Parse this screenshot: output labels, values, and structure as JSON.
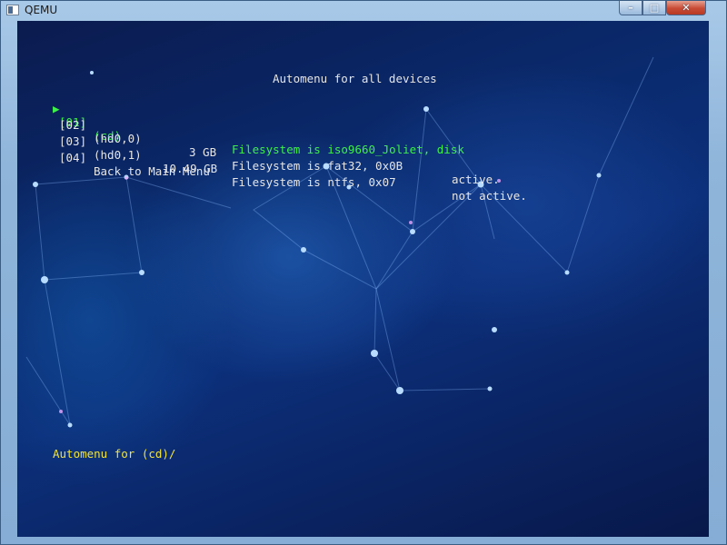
{
  "window": {
    "title": "QEMU",
    "controls": {
      "minimize": "–",
      "maximize": "□",
      "close": "✕"
    }
  },
  "menu": {
    "header": "Automenu for all devices",
    "items": [
      {
        "marker": "▶",
        "index": "[01]",
        "device": "(cd)",
        "size": "",
        "filesystem": "Filesystem is iso9660_Joliet, disk",
        "status": ""
      },
      {
        "marker": "",
        "index": "[02]",
        "device": "(hd0,0)",
        "size": "3 GB",
        "filesystem": "Filesystem is fat32, 0x0B",
        "status": "active."
      },
      {
        "marker": "",
        "index": "[03]",
        "device": "(hd0,1)",
        "size": "10.49 GB",
        "filesystem": "Filesystem is ntfs, 0x07",
        "status": "not active."
      },
      {
        "marker": "",
        "index": "[04]",
        "device": "Back to Main Menu",
        "size": "",
        "filesystem": "",
        "status": ""
      }
    ],
    "selected_index": 0
  },
  "prompt": {
    "text": "Automenu for (cd)/"
  },
  "colors": {
    "selected": "#3df04a",
    "normal": "#e6e6e6",
    "prompt": "#f1e33a",
    "background": "#0a2a6d"
  }
}
